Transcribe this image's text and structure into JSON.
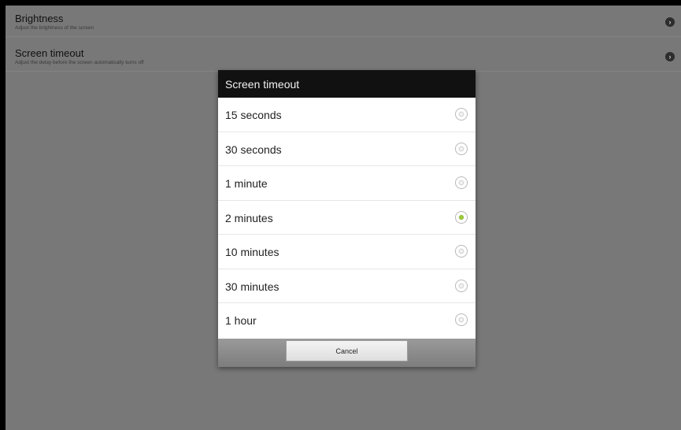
{
  "settings": {
    "brightness": {
      "title": "Brightness",
      "subtitle": "Adjust the brightness of the screen"
    },
    "timeout": {
      "title": "Screen timeout",
      "subtitle": "Adjust the delay before the screen automatically turns off"
    }
  },
  "dialog": {
    "title": "Screen timeout",
    "options": [
      {
        "label": "15 seconds",
        "selected": false
      },
      {
        "label": "30 seconds",
        "selected": false
      },
      {
        "label": "1 minute",
        "selected": false
      },
      {
        "label": "2 minutes",
        "selected": true
      },
      {
        "label": "10 minutes",
        "selected": false
      },
      {
        "label": "30 minutes",
        "selected": false
      },
      {
        "label": "1 hour",
        "selected": false
      }
    ],
    "cancel_label": "Cancel"
  },
  "colors": {
    "accent_selected": "#9ccc3c",
    "dialog_header": "#111111",
    "backdrop": "#787878"
  }
}
